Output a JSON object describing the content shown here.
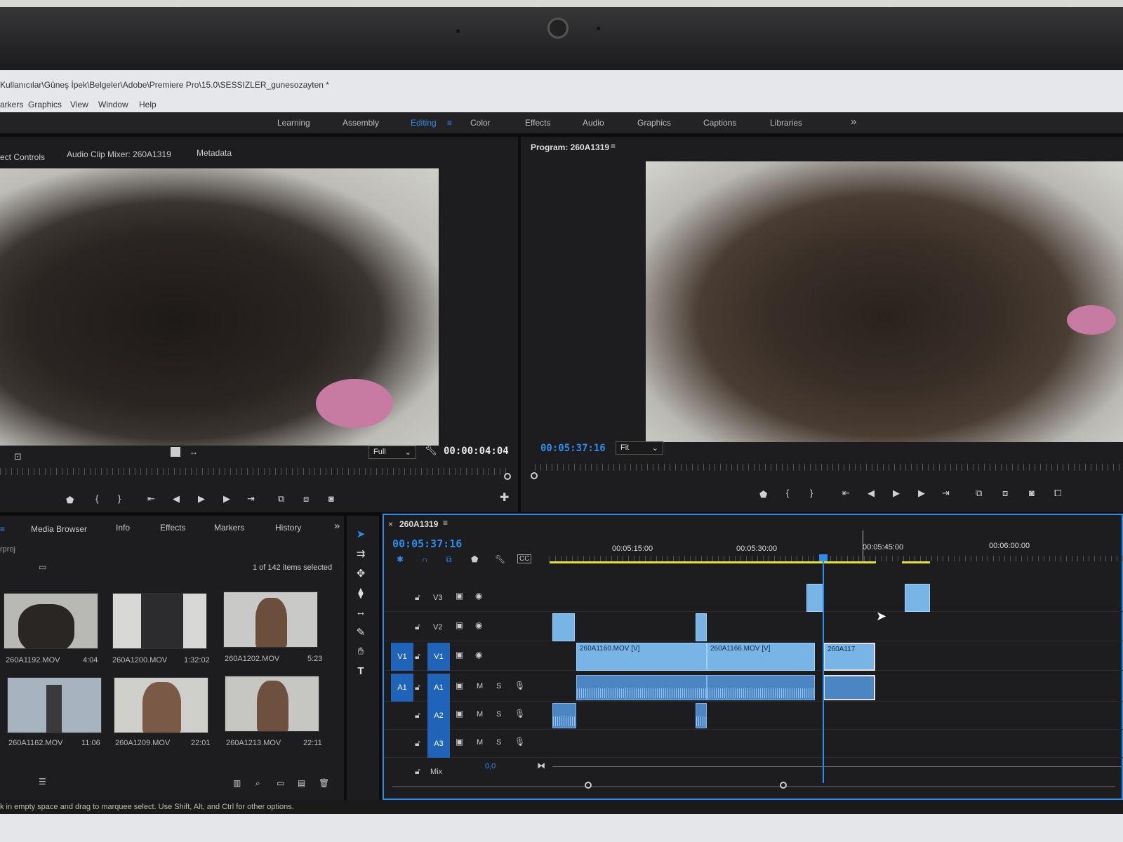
{
  "window": {
    "path": "Kullanıcılar\\Güneş İpek\\Belgeler\\Adobe\\Premiere Pro\\15.0\\SESSIZLER_gunesozayten *"
  },
  "menu": {
    "items": [
      "arkers",
      "Graphics",
      "View",
      "Window",
      "Help"
    ]
  },
  "workspaces": {
    "items": [
      "Learning",
      "Assembly",
      "Editing",
      "Color",
      "Effects",
      "Audio",
      "Graphics",
      "Captions",
      "Libraries"
    ],
    "active": "Editing",
    "overflow": "»"
  },
  "source_panel": {
    "tabs": [
      "ect Controls",
      "Audio Clip Mixer: 260A1319",
      "Metadata"
    ],
    "zoom": "Full",
    "timecode": "00:00:04:04"
  },
  "program_panel": {
    "title": "Program: 260A1319",
    "timecode": "00:05:37:16",
    "zoom": "Fit"
  },
  "project_panel": {
    "tabs": [
      "Media Browser",
      "Info",
      "Effects",
      "Markers",
      "History"
    ],
    "overflow": "»",
    "bin_name": "rproj",
    "selection": "1 of 142 items selected",
    "items": [
      {
        "name": "260A1192.MOV",
        "duration": "4:04"
      },
      {
        "name": "260A1200.MOV",
        "duration": "1:32:02"
      },
      {
        "name": "260A1202.MOV",
        "duration": "5:23"
      },
      {
        "name": "260A1162.MOV",
        "duration": "11:06"
      },
      {
        "name": "260A1209.MOV",
        "duration": "22:01"
      },
      {
        "name": "260A1213.MOV",
        "duration": "22:11"
      }
    ]
  },
  "timeline": {
    "close": "×",
    "sequence": "260A1319",
    "timecode": "00:05:37:16",
    "ruler": [
      "00:05:15:00",
      "00:05:30:00",
      "00:05:45:00",
      "00:06:00:00"
    ],
    "tracks": {
      "video": [
        "V3",
        "V2",
        "V1"
      ],
      "audio": [
        "A1",
        "A2",
        "A3"
      ],
      "source_v": "V1",
      "source_a": "A1",
      "mix_label": "Mix",
      "mix_value": "0,0",
      "mute": "M",
      "solo": "S"
    },
    "clips": [
      "260A1160.MOV [V]",
      "260A1166.MOV [V]",
      "260A117"
    ]
  },
  "status": "k in empty space and drag to marquee select. Use Shift, Alt, and Ctrl for other options."
}
